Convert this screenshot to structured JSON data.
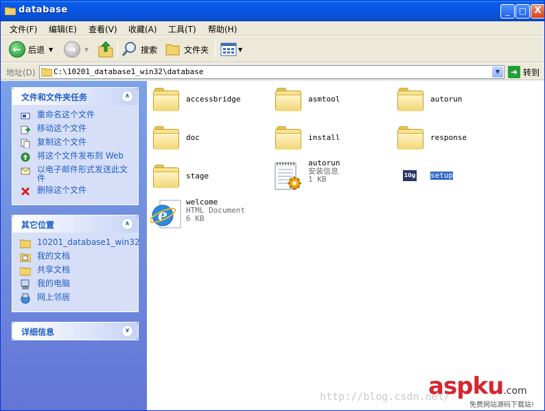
{
  "window": {
    "title": "database",
    "controls": [
      "_",
      "□",
      "X"
    ]
  },
  "menu": [
    "文件(F)",
    "编辑(E)",
    "查看(V)",
    "收藏(A)",
    "工具(T)",
    "帮助(H)"
  ],
  "toolbar": {
    "back_label": "后退",
    "search_label": "搜索",
    "folders_label": "文件夹"
  },
  "address": {
    "label": "地址(D)",
    "value": "C:\\10201_database1_win32\\database",
    "go_label": "转到"
  },
  "tasks_panel": {
    "title": "文件和文件夹任务",
    "items": [
      {
        "label": "重命名这个文件",
        "icon": "rename-icon"
      },
      {
        "label": "移动这个文件",
        "icon": "move-icon"
      },
      {
        "label": "复制这个文件",
        "icon": "copy-icon"
      },
      {
        "label": "将这个文件发布到 Web",
        "icon": "publish-web-icon"
      },
      {
        "label": "以电子邮件形式发送此文件",
        "icon": "email-icon"
      },
      {
        "label": "删除这个文件",
        "icon": "delete-icon"
      }
    ]
  },
  "places_panel": {
    "title": "其它位置",
    "items": [
      {
        "label": "10201_database1_win32",
        "icon": "folder-icon"
      },
      {
        "label": "我的文档",
        "icon": "my-documents-icon"
      },
      {
        "label": "共享文档",
        "icon": "shared-documents-icon"
      },
      {
        "label": "我的电脑",
        "icon": "my-computer-icon"
      },
      {
        "label": "网上邻居",
        "icon": "network-places-icon"
      }
    ]
  },
  "details_panel": {
    "title": "详细信息"
  },
  "files": [
    {
      "name": "accessbridge",
      "type": "folder"
    },
    {
      "name": "asmtool",
      "type": "folder"
    },
    {
      "name": "autorun",
      "type": "folder"
    },
    {
      "name": "doc",
      "type": "folder"
    },
    {
      "name": "install",
      "type": "folder"
    },
    {
      "name": "response",
      "type": "folder"
    },
    {
      "name": "stage",
      "type": "folder"
    },
    {
      "name": "autorun",
      "type": "setup-info",
      "kind": "安装信息",
      "size": "1 KB"
    },
    {
      "name": "setup",
      "type": "executable",
      "selected": true,
      "icon_text": "10g"
    },
    {
      "name": "welcome",
      "type": "html",
      "kind": "HTML Document",
      "size": "6 KB"
    }
  ],
  "watermarks": {
    "url": "http://blog.csdn.net/",
    "site": "aspku",
    "site_tld": ".com",
    "site_sub": "免费网站源码下载站!"
  },
  "colors": {
    "title_bar": "#0a5ce8",
    "task_link": "#215dc6",
    "sidebar": "#7ba2e7",
    "selection": "#316ac5"
  }
}
